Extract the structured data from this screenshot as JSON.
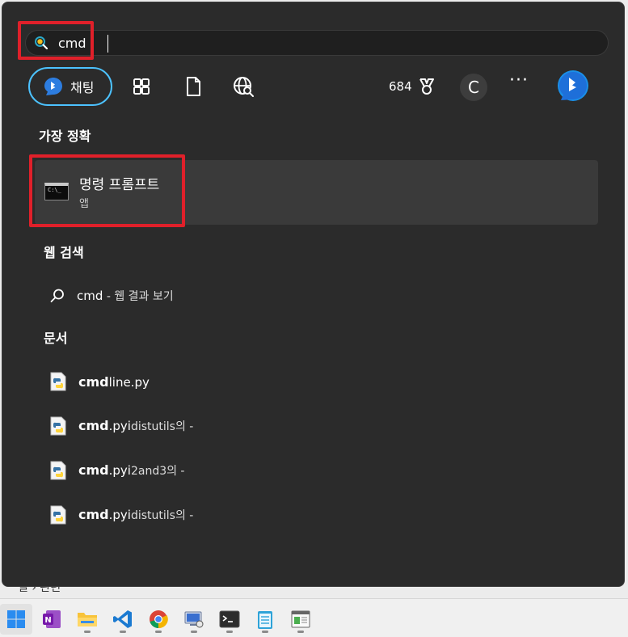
{
  "search": {
    "value": "cmd"
  },
  "toolbar": {
    "chat_label": "채팅",
    "points": "684",
    "avatar_initial": "C",
    "more": "···"
  },
  "sections": {
    "best_match": "가장 정확",
    "web_search": "웹 검색",
    "documents": "문서"
  },
  "best_match": {
    "title": "명령 프롬프트",
    "subtitle": "앱",
    "icon_text": "C:\\_"
  },
  "web_result": {
    "query": "cmd",
    "suffix": " - 웹 결과 보기"
  },
  "documents": [
    {
      "bold": "cmd",
      "rest": "line.py",
      "suffix": ""
    },
    {
      "bold": "cmd",
      "rest": ".pyi",
      "suffix": "distutils의 -"
    },
    {
      "bold": "cmd",
      "rest": ".pyi",
      "suffix": "2and3의 -"
    },
    {
      "bold": "cmd",
      "rest": ".pyi",
      "suffix": "distutils의 -"
    }
  ],
  "background": {
    "crumb": "필 › 관련"
  },
  "colors": {
    "accent": "#4cc2ff",
    "highlight": "#e0202a",
    "panel": "#2b2b2b"
  }
}
